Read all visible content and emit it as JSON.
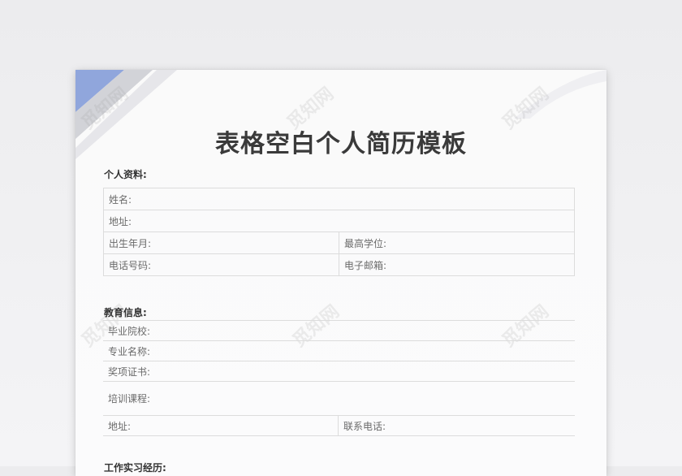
{
  "document": {
    "title": "表格空白个人简历模板",
    "watermark": "觅知网",
    "colors": {
      "accent": "#90a6dc",
      "gray_band": "#d5d5d8",
      "title": "#3a3a3a"
    }
  },
  "personal": {
    "heading": "个人资料:",
    "name": "姓名:",
    "address": "地址:",
    "birth": "出生年月:",
    "degree": "最高学位:",
    "phone": "电话号码:",
    "email": "电子邮箱:"
  },
  "education": {
    "heading": "教育信息:",
    "school": "毕业院校:",
    "major": "专业名称:",
    "awards": "奖项证书:",
    "training": "培训课程:",
    "address": "地址:",
    "contact_phone": "联系电话:"
  },
  "work": {
    "heading": "工作实习经历:"
  }
}
